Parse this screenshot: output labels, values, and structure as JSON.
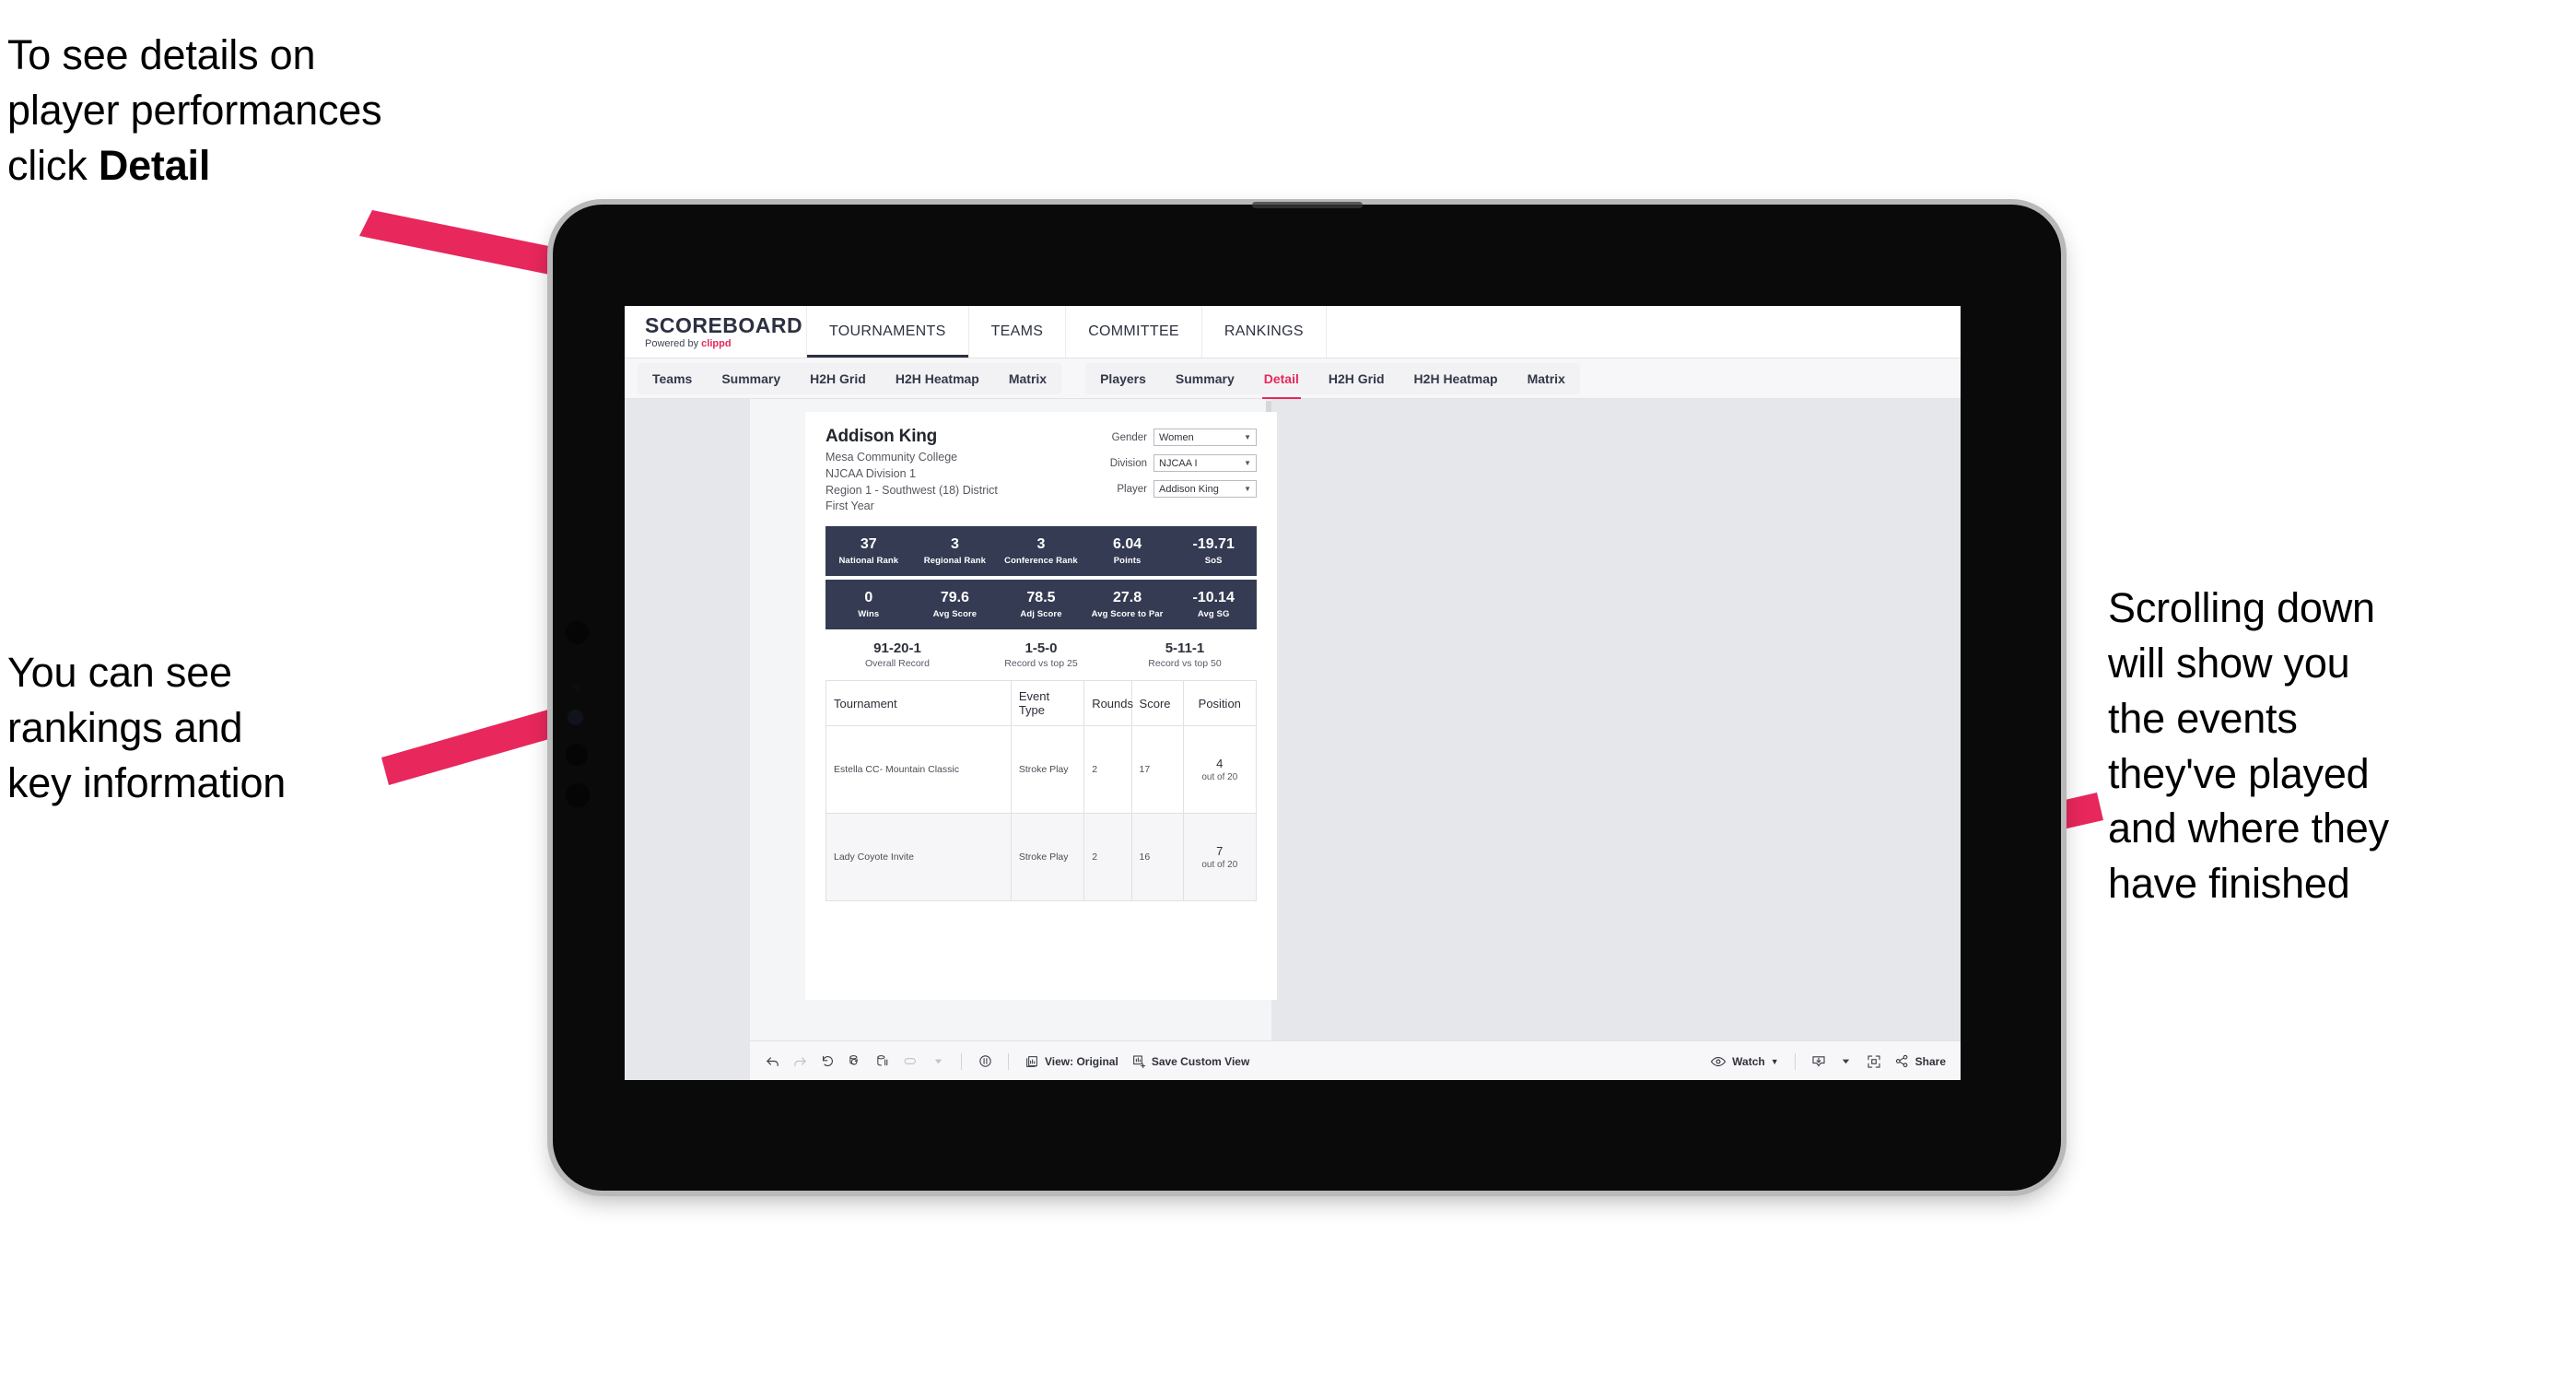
{
  "annotations": {
    "detail": "To see details on\nplayer performances\nclick ",
    "detail_bold": "Detail",
    "rankings": "You can see\nrankings and\nkey information",
    "scrolling": "Scrolling down\nwill show you\nthe events\nthey've played\nand where they\nhave finished"
  },
  "colors": {
    "accent_pink": "#e8275c",
    "band_navy": "#343b52",
    "arrow": "#e8275c"
  },
  "app": {
    "brand": {
      "title": "SCOREBOARD",
      "powered_prefix": "Powered by ",
      "powered_name": "clippd"
    },
    "nav": [
      {
        "label": "TOURNAMENTS",
        "active": true
      },
      {
        "label": "TEAMS",
        "active": false
      },
      {
        "label": "COMMITTEE",
        "active": false
      },
      {
        "label": "RANKINGS",
        "active": false
      }
    ],
    "tabs_left": [
      {
        "label": "Teams",
        "selected": false
      },
      {
        "label": "Summary",
        "selected": false
      },
      {
        "label": "H2H Grid",
        "selected": false
      },
      {
        "label": "H2H Heatmap",
        "selected": false
      },
      {
        "label": "Matrix",
        "selected": false
      }
    ],
    "tabs_right": [
      {
        "label": "Players",
        "selected": false
      },
      {
        "label": "Summary",
        "selected": false
      },
      {
        "label": "Detail",
        "selected": true
      },
      {
        "label": "H2H Grid",
        "selected": false
      },
      {
        "label": "H2H Heatmap",
        "selected": false
      },
      {
        "label": "Matrix",
        "selected": false
      }
    ]
  },
  "player": {
    "name": "Addison King",
    "college": "Mesa Community College",
    "division": "NJCAA Division 1",
    "region": "Region 1 - Southwest (18) District",
    "year": "First Year"
  },
  "filters": [
    {
      "label": "Gender",
      "value": "Women"
    },
    {
      "label": "Division",
      "value": "NJCAA I"
    },
    {
      "label": "Player",
      "value": "Addison King"
    }
  ],
  "stats_band_1": [
    {
      "value": "37",
      "label": "National Rank"
    },
    {
      "value": "3",
      "label": "Regional Rank"
    },
    {
      "value": "3",
      "label": "Conference Rank"
    },
    {
      "value": "6.04",
      "label": "Points"
    },
    {
      "value": "-19.71",
      "label": "SoS"
    }
  ],
  "stats_band_2": [
    {
      "value": "0",
      "label": "Wins"
    },
    {
      "value": "79.6",
      "label": "Avg Score"
    },
    {
      "value": "78.5",
      "label": "Adj Score"
    },
    {
      "value": "27.8",
      "label": "Avg Score to Par"
    },
    {
      "value": "-10.14",
      "label": "Avg SG"
    }
  ],
  "records": [
    {
      "value": "91-20-1",
      "label": "Overall Record"
    },
    {
      "value": "1-5-0",
      "label": "Record vs top 25"
    },
    {
      "value": "5-11-1",
      "label": "Record vs top 50"
    }
  ],
  "events_table": {
    "columns": [
      "Tournament",
      "Event Type",
      "Rounds",
      "Score",
      "Position"
    ],
    "rows": [
      {
        "tournament": "Estella CC- Mountain Classic",
        "event_type": "Stroke Play",
        "rounds": "2",
        "score": "17",
        "position": "4",
        "position_out_of": "out of 20"
      },
      {
        "tournament": "Lady Coyote Invite",
        "event_type": "Stroke Play",
        "rounds": "2",
        "score": "16",
        "position": "7",
        "position_out_of": "out of 20"
      }
    ]
  },
  "toolbar": {
    "view_label": "View: Original",
    "save_label": "Save Custom View",
    "watch_label": "Watch",
    "share_label": "Share"
  }
}
